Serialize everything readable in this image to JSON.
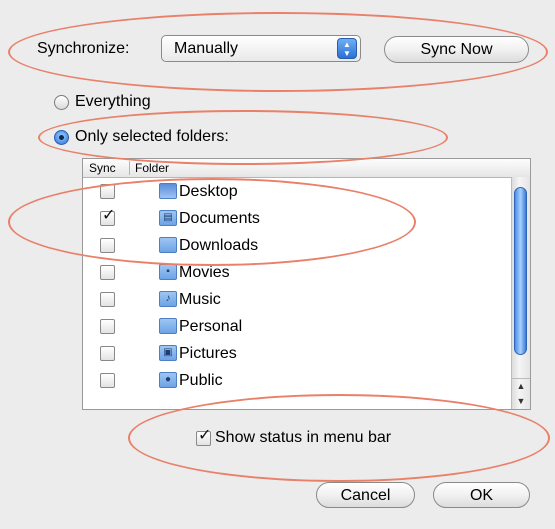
{
  "toolbar": {
    "sync_label": "Synchronize:",
    "mode_value": "Manually",
    "sync_now_label": "Sync Now"
  },
  "scope": {
    "everything_label": "Everything",
    "only_selected_label": "Only selected folders:",
    "selected": "only_selected"
  },
  "list": {
    "header_sync": "Sync",
    "header_folder": "Folder",
    "rows": [
      {
        "name": "Desktop",
        "checked": false,
        "icon": "desktop-folder-icon"
      },
      {
        "name": "Documents",
        "checked": true,
        "icon": "documents-folder-icon"
      },
      {
        "name": "Downloads",
        "checked": false,
        "icon": "downloads-folder-icon"
      },
      {
        "name": "Movies",
        "checked": false,
        "icon": "movies-folder-icon"
      },
      {
        "name": "Music",
        "checked": false,
        "icon": "music-folder-icon"
      },
      {
        "name": "Personal",
        "checked": false,
        "icon": "folder-icon"
      },
      {
        "name": "Pictures",
        "checked": false,
        "icon": "pictures-folder-icon"
      },
      {
        "name": "Public",
        "checked": false,
        "icon": "public-folder-icon"
      }
    ]
  },
  "options": {
    "show_status_label": "Show status in menu bar",
    "show_status_checked": true
  },
  "buttons": {
    "cancel_label": "Cancel",
    "ok_label": "OK"
  },
  "colors": {
    "accent": "#2b70d8",
    "annotation": "#e9806a",
    "window_bg": "#ececec"
  }
}
